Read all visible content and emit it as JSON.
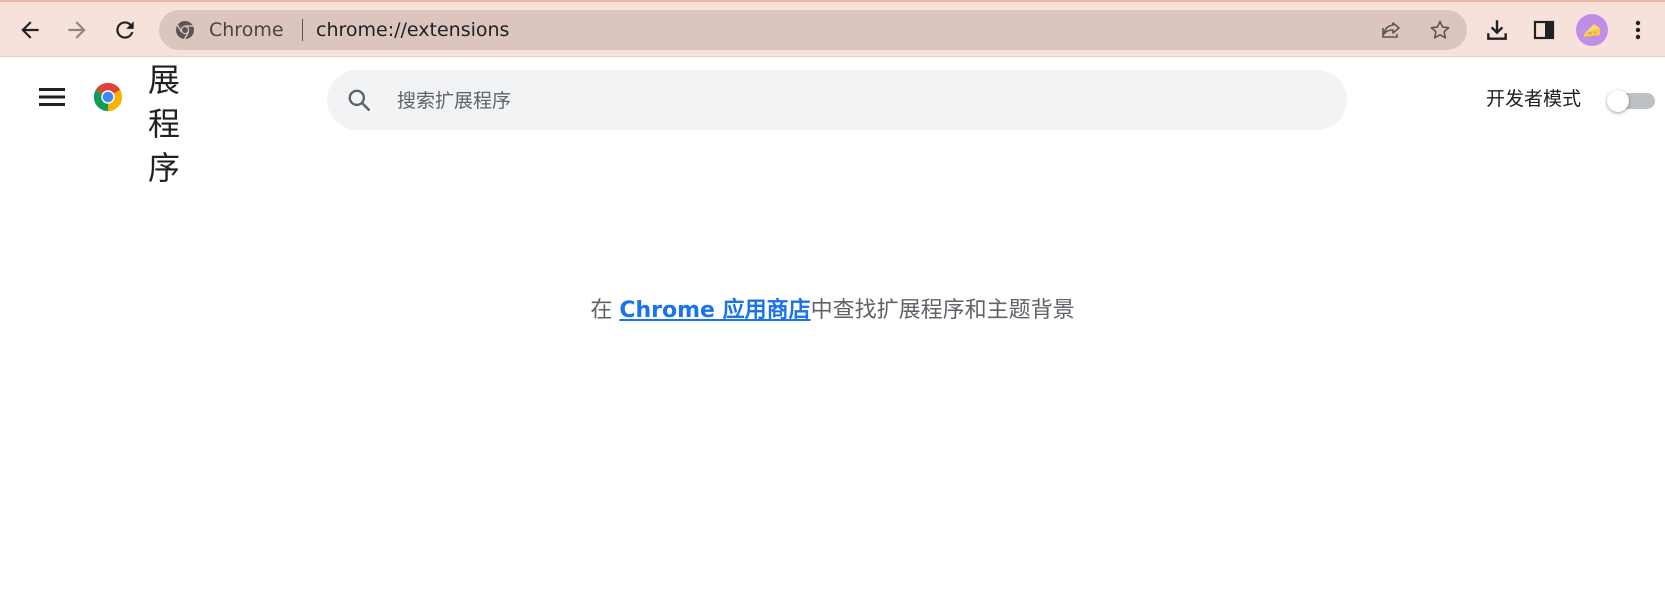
{
  "browser": {
    "back_icon": "arrow-back-icon",
    "forward_icon": "arrow-forward-icon",
    "reload_icon": "reload-icon",
    "omnibox": {
      "site_name": "Chrome",
      "url": "chrome://extensions"
    },
    "share_icon": "share-icon",
    "bookmark_icon": "star-icon",
    "download_icon": "download-icon",
    "side_panel_icon": "side-panel-icon",
    "avatar_icon": "cheese-avatar-icon",
    "menu_icon": "more-vert-icon",
    "frame_color": "#f6e1db",
    "omnibox_color": "#dcc5bf"
  },
  "header": {
    "title": "展程序",
    "search": {
      "placeholder": "搜索扩展程序",
      "value": ""
    },
    "developer_mode": {
      "label": "开发者模式",
      "enabled": false
    }
  },
  "empty_state": {
    "prefix": "在 ",
    "link_text": "Chrome 应用商店",
    "suffix": "中查找扩展程序和主题背景",
    "link_color": "#1a73e8"
  }
}
